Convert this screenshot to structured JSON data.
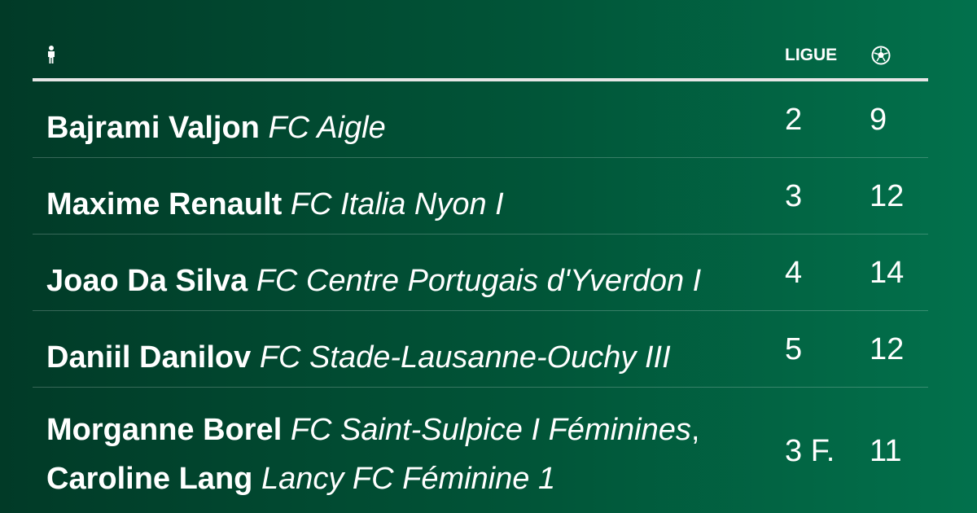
{
  "header": {
    "player_icon": "person-icon",
    "league_label": "LIGUE",
    "goals_icon": "soccer-ball-icon"
  },
  "rows": [
    {
      "players": [
        {
          "name": "Bajrami Valjon",
          "club": "FC Aigle"
        }
      ],
      "league": "2",
      "goals": "9"
    },
    {
      "players": [
        {
          "name": "Maxime Renault",
          "club": "FC Italia Nyon I"
        }
      ],
      "league": "3",
      "goals": "12"
    },
    {
      "players": [
        {
          "name": "Joao Da Silva",
          "club": "FC Centre Portugais d'Yverdon I"
        }
      ],
      "league": "4",
      "goals": "14"
    },
    {
      "players": [
        {
          "name": "Daniil Danilov",
          "club": "FC Stade-Lausanne-Ouchy III"
        }
      ],
      "league": "5",
      "goals": "12"
    },
    {
      "players": [
        {
          "name": "Morganne Borel",
          "club": "FC Saint-Sulpice I Féminines",
          "separator": ","
        },
        {
          "name": "Caroline Lang",
          "club": "Lancy FC Féminine 1"
        }
      ],
      "league": "3 F.",
      "goals": "11"
    }
  ],
  "colors": {
    "background_start": "#013a27",
    "background_end": "#02714c",
    "text": "#ffffff",
    "header_rule": "#e6e6e6"
  }
}
